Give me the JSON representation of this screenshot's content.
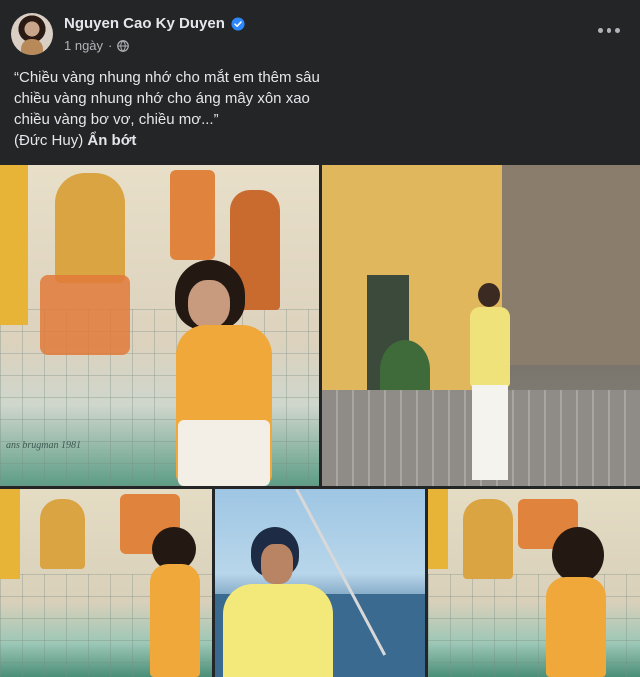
{
  "post": {
    "author": "Nguyen Cao Ky Duyen",
    "verified_icon": "verified-badge-icon",
    "time": "1 ngày",
    "separator": "·",
    "audience_icon": "globe-icon",
    "more_icon": "more-options-icon"
  },
  "caption": {
    "lines": [
      "“Chiều vàng nhung nhớ cho mắt em thêm sâu",
      "chiều vàng nhung nhớ cho áng mây xôn xao",
      "chiều vàng bơ vơ, chiều mơ...”"
    ],
    "credit": "(Đức Huy)",
    "see_less": "Ẩn bớt"
  },
  "photos": {
    "photo_1": {
      "inscription": "ans brugman 1981"
    }
  },
  "colors": {
    "background": "#242526",
    "text": "#e4e6eb",
    "secondary_text": "#b0b3b8",
    "verified": "#2d88ff"
  }
}
